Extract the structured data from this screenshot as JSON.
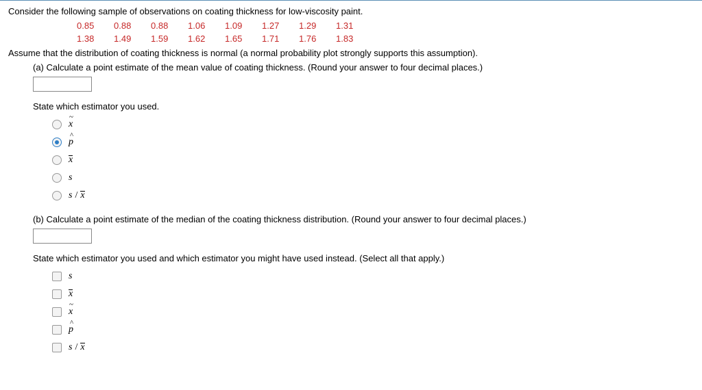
{
  "intro": "Consider the following sample of observations on coating thickness for low-viscosity paint.",
  "data": {
    "row1": [
      "0.85",
      "0.88",
      "0.88",
      "1.06",
      "1.09",
      "1.27",
      "1.29",
      "1.31"
    ],
    "row2": [
      "1.38",
      "1.49",
      "1.59",
      "1.62",
      "1.65",
      "1.71",
      "1.76",
      "1.83"
    ]
  },
  "assume": "Assume that the distribution of coating thickness is normal (a normal probability plot strongly supports this assumption).",
  "partA": {
    "prompt": "(a) Calculate a point estimate of the mean value of coating thickness. (Round your answer to four decimal places.)",
    "state": "State which estimator you used.",
    "options": [
      {
        "key": "x_tilde",
        "label": "x",
        "decor": "tilde",
        "selected": false
      },
      {
        "key": "p_hat",
        "label": "p",
        "decor": "hat",
        "selected": true
      },
      {
        "key": "x_bar",
        "label": "x",
        "decor": "bar",
        "selected": false
      },
      {
        "key": "s",
        "label": "s",
        "decor": "",
        "selected": false
      },
      {
        "key": "s_over_xbar",
        "label": "s / x̄",
        "decor": "sx",
        "selected": false
      }
    ]
  },
  "partB": {
    "prompt": "(b) Calculate a point estimate of the median of the coating thickness distribution. (Round your answer to four decimal places.)",
    "state": "State which estimator you used and which estimator you might have used instead. (Select all that apply.)",
    "options": [
      {
        "key": "s",
        "label": "s",
        "decor": ""
      },
      {
        "key": "x_bar",
        "label": "x",
        "decor": "bar"
      },
      {
        "key": "x_tilde",
        "label": "x",
        "decor": "tilde"
      },
      {
        "key": "p_hat",
        "label": "p",
        "decor": "hat"
      },
      {
        "key": "s_over_xbar",
        "label": "s / x̄",
        "decor": "sx"
      }
    ]
  }
}
